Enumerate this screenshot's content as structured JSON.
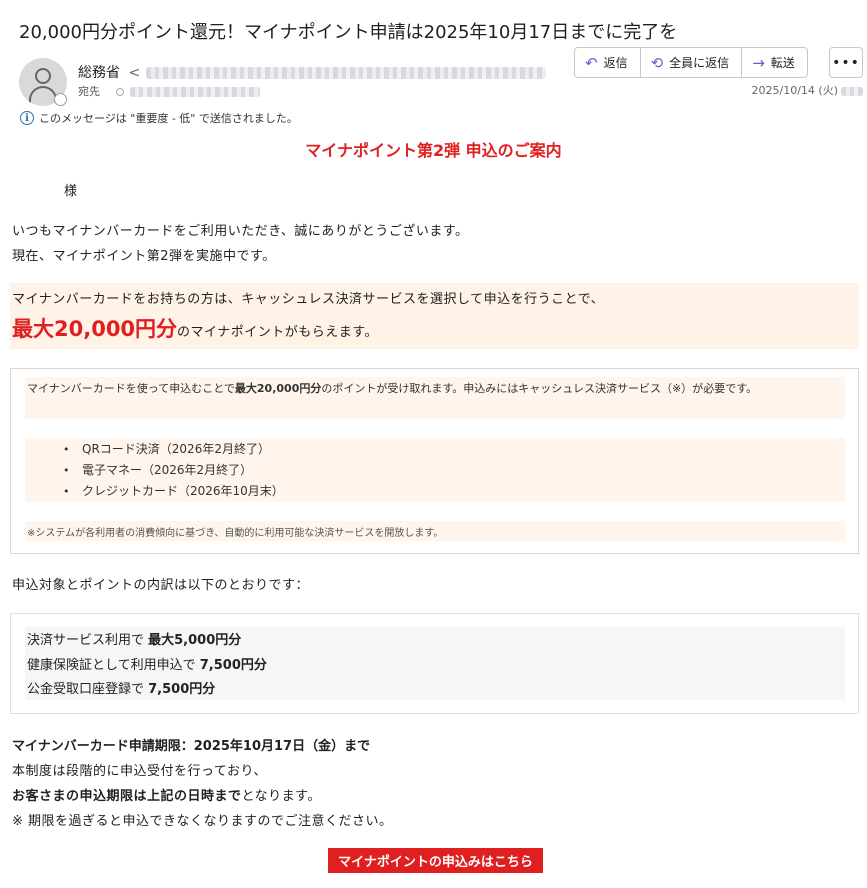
{
  "email": {
    "subject": "20,000円分ポイント還元！マイナポイント申請は2025年10月17日までに完了を",
    "sender_name": "総務省",
    "sender_prefix": "<",
    "to_label": "宛先",
    "date": "2025/10/14 (火)",
    "importance_notice": "このメッセージは \"重要度 - 低\" で送信されました。"
  },
  "actions": {
    "reply": "返信",
    "reply_all": "全員に返信",
    "forward": "転送",
    "more": "•••"
  },
  "icons": {
    "avatar": "person-icon",
    "reply": "reply-arrow-icon",
    "reply_all": "reply-all-arrow-icon",
    "forward": "forward-arrow-icon",
    "info": "info-icon"
  },
  "colors": {
    "accent_red": "#e02020",
    "highlight_bg": "#fff3e8",
    "button_icon": "#5b62c8"
  },
  "body": {
    "heading": "マイナポイント第2弾 申込のご案内",
    "salutation": "様",
    "intro1": "いつもマイナンバーカードをご利用いただき、誠にありがとうございます。",
    "intro2": "現在、マイナポイント第2弾を実施中です。",
    "highlight_line1": "マイナンバーカードをお持ちの方は、キャッシュレス決済サービスを選択して申込を行うことで、",
    "highlight_big": "最大20,000円分",
    "highlight_rest": "のマイナポイントがもらえます。",
    "box_text_a": "マイナンバーカードを使って申込むことで",
    "box_text_bold": "最大20,000円分",
    "box_text_b": "のポイントが受け取れます。申込みにはキャッシュレス決済サービス（※）が必要です。",
    "payment_services": [
      "QRコード決済（2026年2月終了）",
      "電子マネー（2026年2月終了）",
      "クレジットカード（2026年10月末）"
    ],
    "note": "※システムが各利用者の消費傾向に基づき、自動的に利用可能な決済サービスを開放します。",
    "breakdown_intro": "申込対象とポイントの内訳は以下のとおりです：",
    "breakdown": [
      {
        "label": "決済サービス利用で ",
        "value": "最大5,000円分"
      },
      {
        "label": "健康保険証として利用申込で ",
        "value": "7,500円分"
      },
      {
        "label": "公金受取口座登録で ",
        "value": "7,500円分"
      }
    ],
    "deadline": "マイナンバーカード申請期限：2025年10月17日（金）まで",
    "info1": "本制度は段階的に申込受付を行っており、",
    "info2_bold": "お客さまの申込期限は上記の日時まで",
    "info2_rest": "となります。",
    "info3": "※ 期限を過ぎると申込できなくなりますのでご注意ください。",
    "cta": "マイナポイントの申込みはこちら"
  }
}
